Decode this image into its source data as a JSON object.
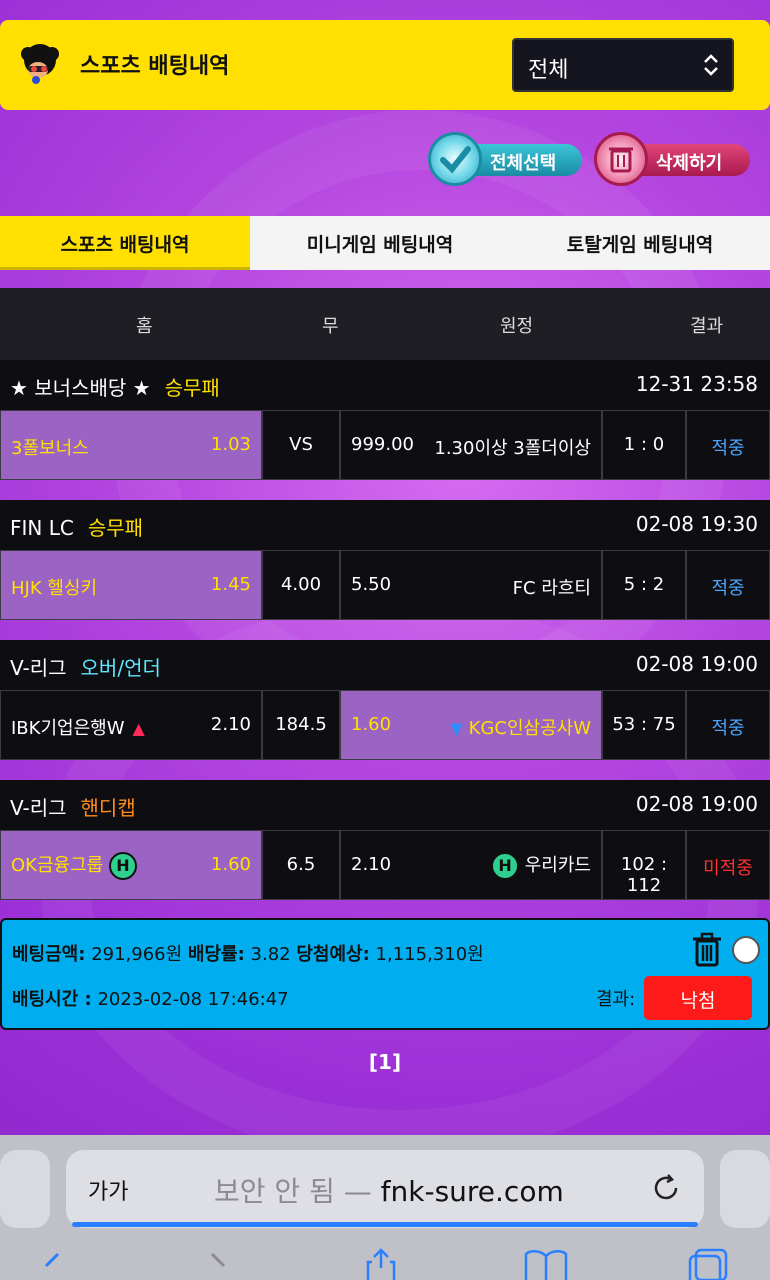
{
  "header": {
    "title": "스포츠 배팅내역",
    "filter_value": "전체"
  },
  "actions": {
    "select_all": "전체선택",
    "delete": "삭제하기"
  },
  "tabs": [
    "스포츠 배팅내역",
    "미니게임 베팅내역",
    "토탈게임 베팅내역"
  ],
  "columns": {
    "home": "홈",
    "draw": "무",
    "away": "원정",
    "result": "결과"
  },
  "games": [
    {
      "league": "★ 보너스배당 ★",
      "market": "승무패",
      "time": "12-31 23:58",
      "home": "3폴보너스",
      "home_odd": "1.03",
      "draw": "VS",
      "away_odd": "999.00",
      "away": "1.30이상 3폴더이상",
      "score": "1 : 0",
      "status": "적중"
    },
    {
      "league": "FIN LC",
      "market": "승무패",
      "time": "02-08 19:30",
      "home": "HJK 헬싱키",
      "home_odd": "1.45",
      "draw": "4.00",
      "away_odd": "5.50",
      "away": "FC 라흐티",
      "score": "5 : 2",
      "status": "적중"
    },
    {
      "league": "V-리그",
      "market": "오버/언더",
      "time": "02-08 19:00",
      "home": "IBK기업은행W",
      "home_odd": "2.10",
      "draw": "184.5",
      "away_odd": "1.60",
      "away": "KGC인삼공사W",
      "score": "53 : 75",
      "status": "적중"
    },
    {
      "league": "V-리그",
      "market": "핸디캡",
      "time": "02-08 19:00",
      "home": "OK금융그룹",
      "home_odd": "1.60",
      "draw": "6.5",
      "away_odd": "2.10",
      "away": "우리카드",
      "score": "102 : 112",
      "status": "미적중"
    }
  ],
  "summary": {
    "bet_amount_label": "베팅금액:",
    "bet_amount": "291,966원",
    "odds_label": "배당률:",
    "odds": "3.82",
    "expected_label": "당첨예상:",
    "expected": "1,115,310원",
    "bet_time_label": "배팅시간 :",
    "bet_time": "2023-02-08 17:46:47",
    "result_label": "결과:",
    "result": "낙첨"
  },
  "pager": "[1]",
  "browser": {
    "aa": "가가",
    "insecure": "보안 안 됨 —",
    "domain": "fnk-sure.com"
  },
  "colors": {
    "accent_yellow": "#ffe000",
    "highlight_purple": "#9a63c4",
    "summary_blue": "#00aef0",
    "lose_red": "#ff1a1a"
  }
}
